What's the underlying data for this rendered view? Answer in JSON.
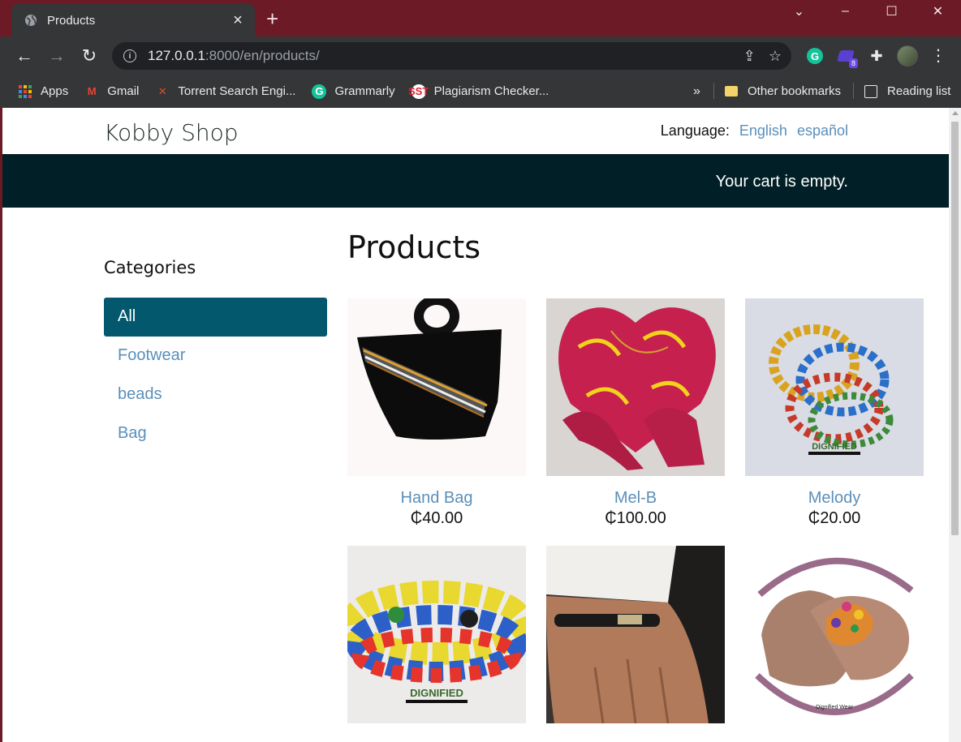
{
  "browser": {
    "tab_title": "Products",
    "new_tab_symbol": "+",
    "close_symbol": "×",
    "url_host": "127.0.0.1",
    "url_rest": ":8000/en/products/",
    "window_controls": [
      "⌄",
      "–",
      "☐",
      "✕"
    ],
    "bookmarks": [
      "Apps",
      "Gmail",
      "Torrent Search Engi...",
      "Grammarly",
      "Plagiarism Checker..."
    ],
    "more_bookmarks": "»",
    "other_bookmarks": "Other bookmarks",
    "reading_list": "Reading list",
    "extension_badge": "8"
  },
  "site": {
    "logo": "Kobby Shop",
    "language_label": "Language:",
    "languages": [
      "English",
      "español"
    ],
    "cart_text": "Your cart is empty.",
    "categories_heading": "Categories",
    "categories": [
      "All",
      "Footwear",
      "beads",
      "Bag"
    ],
    "active_category": "All",
    "page_title": "Products",
    "products": [
      {
        "name": "Hand Bag",
        "price": "₵40.00"
      },
      {
        "name": "Mel-B",
        "price": "₵100.00"
      },
      {
        "name": "Melody",
        "price": "₵20.00"
      },
      {
        "name": "",
        "price": ""
      },
      {
        "name": "",
        "price": ""
      },
      {
        "name": "",
        "price": ""
      }
    ],
    "logo_text_on_images": "DIGNIFIED",
    "footwear_caption": "Dignified Wear"
  },
  "colors": {
    "link": "#5b8fb9",
    "active_category": "#03586d",
    "cart_bar": "#011f26",
    "browser_frame": "#6b1a26"
  }
}
